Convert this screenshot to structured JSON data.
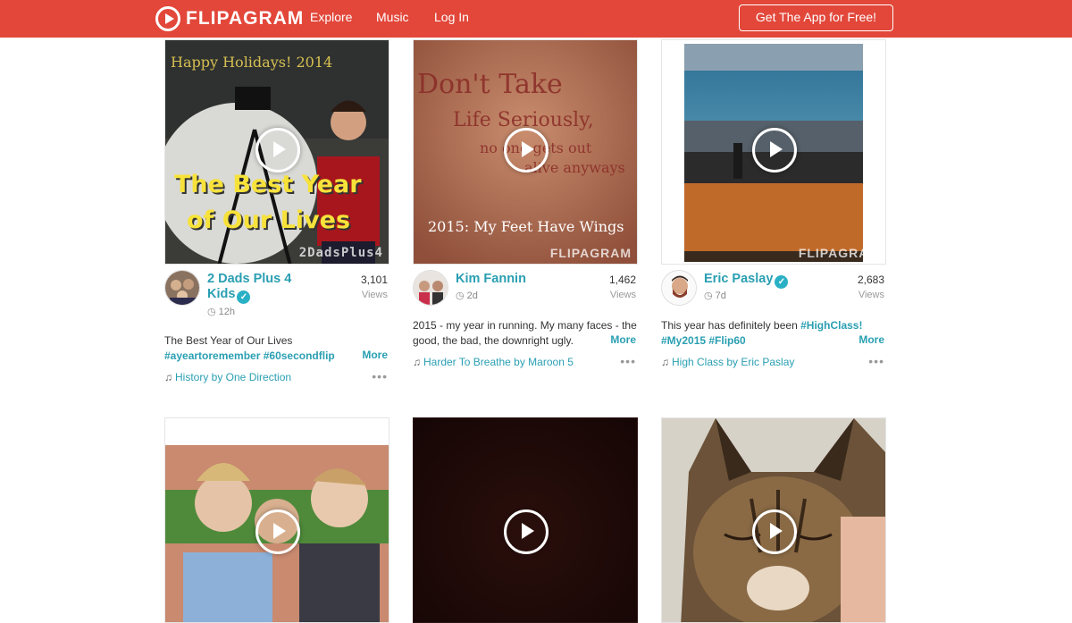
{
  "header": {
    "brand": "FLIPAGRAM",
    "nav": [
      "Explore",
      "Music",
      "Log In"
    ],
    "cta": "Get The App for Free!"
  },
  "icons": [
    "flipagram-logo-icon",
    "play-icon",
    "verified-badge-icon",
    "clock-icon",
    "music-note-icon",
    "more-options-icon"
  ],
  "colors": {
    "brand": "#e2473a",
    "link": "#2a9fb2"
  },
  "cards": [
    {
      "overlay": [
        "The Best Year",
        "of Our Lives"
      ],
      "thumb_caption": "2DadsPlus4",
      "user": "2 Dads Plus 4 Kids",
      "verified": true,
      "age": "12h",
      "views": "3,101",
      "views_label": "Views",
      "desc": "The Best Year of Our Lives",
      "tags": "#ayeartoremember #60secondflip",
      "more": "More",
      "song": "History by One Direction"
    },
    {
      "overlay": [
        "Don't Take",
        "Life Seriously,",
        "no one gets out",
        "alive anyways"
      ],
      "thumb_caption": "2015: My Feet Have Wings",
      "watermark": "FLIPAGRAM",
      "user": "Kim Fannin",
      "verified": false,
      "age": "2d",
      "views": "1,462",
      "views_label": "Views",
      "desc": "2015 - my year in running. My many faces - the good, the bad, the downright ugly.",
      "more": "More",
      "song": "Harder To Breathe by Maroon 5"
    },
    {
      "watermark": "FLIPAGRAM",
      "user": "Eric Paslay",
      "verified": true,
      "age": "7d",
      "views": "2,683",
      "views_label": "Views",
      "desc": "This year has definitely been",
      "tags": "#HighClass! #My2015 #Flip60",
      "more": "More",
      "song": "High Class by Eric Paslay"
    }
  ]
}
